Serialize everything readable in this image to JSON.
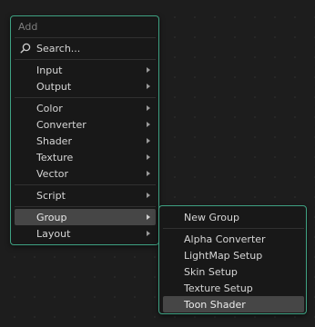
{
  "add_menu": {
    "title": "Add",
    "search_label": "Search...",
    "items": [
      {
        "label": "Input",
        "has_submenu": true
      },
      {
        "label": "Output",
        "has_submenu": true
      },
      {
        "label": "Color",
        "has_submenu": true
      },
      {
        "label": "Converter",
        "has_submenu": true
      },
      {
        "label": "Shader",
        "has_submenu": true
      },
      {
        "label": "Texture",
        "has_submenu": true
      },
      {
        "label": "Vector",
        "has_submenu": true
      },
      {
        "label": "Script",
        "has_submenu": true
      },
      {
        "label": "Group",
        "has_submenu": true,
        "active": true
      },
      {
        "label": "Layout",
        "has_submenu": true
      }
    ]
  },
  "group_submenu": {
    "items": [
      {
        "label": "New Group"
      },
      {
        "label": "Alpha Converter"
      },
      {
        "label": "LightMap Setup"
      },
      {
        "label": "Skin Setup"
      },
      {
        "label": "Texture Setup"
      },
      {
        "label": "Toon Shader",
        "active": true
      }
    ]
  },
  "colors": {
    "accent_border": "#3fa283",
    "menu_bg": "#181818",
    "active_bg": "#464646",
    "canvas_bg": "#1d1d1d"
  }
}
